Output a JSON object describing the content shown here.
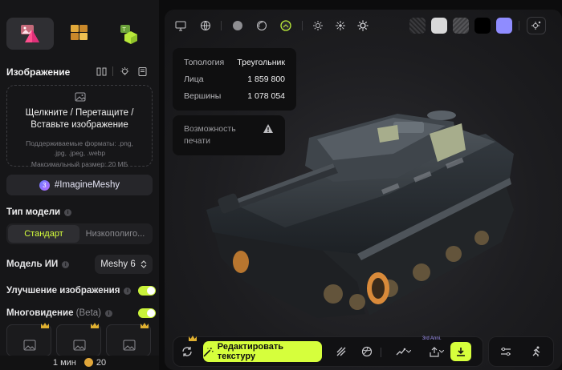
{
  "sidebar": {
    "image_section_title": "Изображение",
    "upload_main": "Щелкните / Перетащите / Вставьте изображение",
    "upload_formats": "Поддерживаемые форматы: .png, .jpg, .jpeg, .webp",
    "upload_maxsize": "Максимальный размер: 20 МБ",
    "hashtag": "#ImagineMeshy",
    "hashtag_badge": "3",
    "model_type_label": "Тип модели",
    "model_type_options": [
      "Стандарт",
      "Низкополиго..."
    ],
    "ai_model_label": "Модель ИИ",
    "ai_model_value": "Meshy 6",
    "image_enhance_label": "Улучшение изображения",
    "multiview_label": "Многовидение",
    "multiview_beta": "(Beta)",
    "time": "1 мин",
    "credits": "20"
  },
  "viewport": {
    "stats": [
      {
        "key": "Топология",
        "value": "Треугольник"
      },
      {
        "key": "Лица",
        "value": "1 859 800"
      },
      {
        "key": "Вершины",
        "value": "1 078 054"
      }
    ],
    "print_warning": "Возможность печати",
    "swatches": [
      "#2a2a2c",
      "#d9d9da",
      "#4a4a4d",
      "#000000",
      "#8f8cff"
    ],
    "toolbar": {
      "edit_texture": "Редактировать текстуру",
      "third_party_tag": "3rd Anni."
    }
  },
  "colors": {
    "accent": "#d6ff3c",
    "panel": "#161618"
  }
}
